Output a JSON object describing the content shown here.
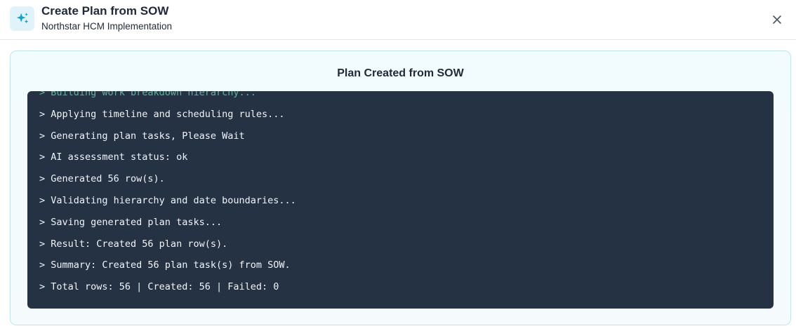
{
  "header": {
    "title": "Create Plan from SOW",
    "subtitle": "Northstar HCM Implementation",
    "icon": "sparkle-icon",
    "close_icon": "close-icon"
  },
  "card": {
    "title": "Plan Created from SOW"
  },
  "log": {
    "lines": [
      "> Building work breakdown hierarchy...",
      "> Applying timeline and scheduling rules...",
      "> Generating plan tasks, Please Wait",
      "> AI assessment status: ok",
      "> Generated 56 row(s).",
      "> Validating hierarchy and date boundaries...",
      "> Saving generated plan tasks...",
      "> Result: Created 56 plan row(s).",
      "> Summary: Created 56 plan task(s) from SOW.",
      "> Total rows: 56 | Created: 56 | Failed: 0"
    ]
  },
  "colors": {
    "accent": "#0ea5c9",
    "terminal_bg": "#253244",
    "terminal_text": "#f1f5f9",
    "faded_text": "#5fb39a",
    "card_border": "#bfe6ee"
  }
}
